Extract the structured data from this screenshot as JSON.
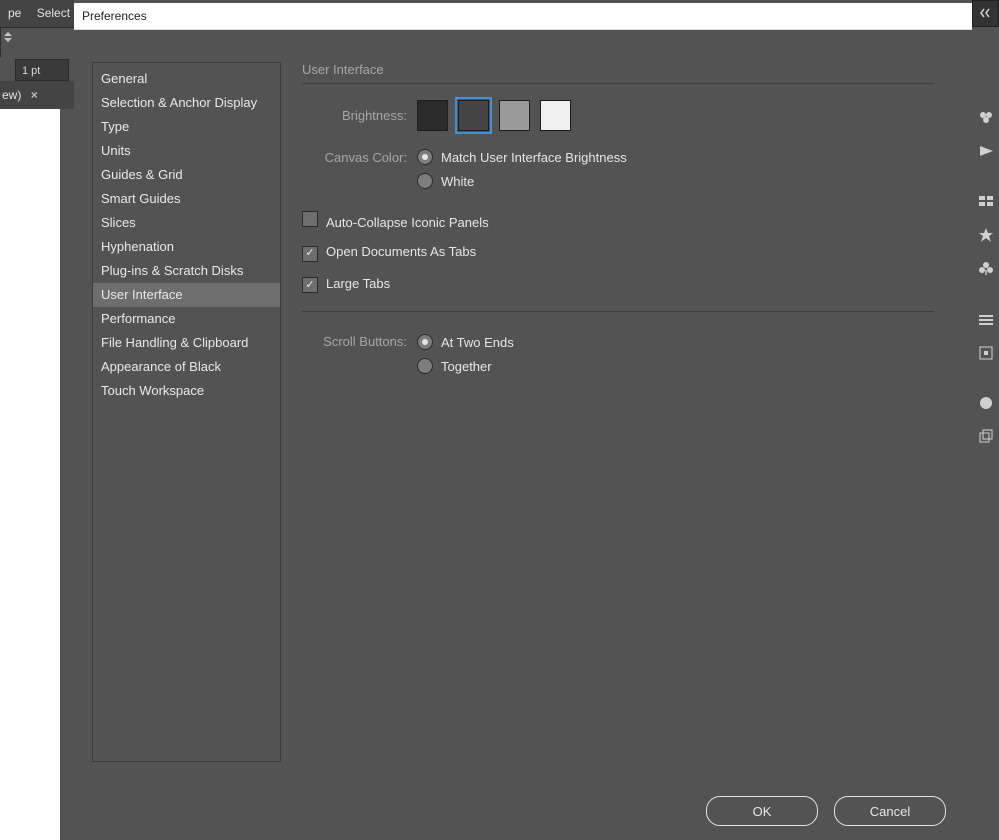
{
  "background": {
    "menu_items": [
      "pe",
      "Select"
    ],
    "stroke_value": "1 pt",
    "doc_tab": "ew)",
    "doc_tab_close": "×"
  },
  "dialog": {
    "title": "Preferences",
    "categories": [
      "General",
      "Selection & Anchor Display",
      "Type",
      "Units",
      "Guides & Grid",
      "Smart Guides",
      "Slices",
      "Hyphenation",
      "Plug-ins & Scratch Disks",
      "User Interface",
      "Performance",
      "File Handling & Clipboard",
      "Appearance of Black",
      "Touch Workspace"
    ],
    "selected_category_index": 9,
    "panel": {
      "heading": "User Interface",
      "brightness_label": "Brightness:",
      "swatches": [
        "#2b2b2b",
        "#444444",
        "#9a9a9a",
        "#f0f0f0"
      ],
      "selected_swatch_index": 1,
      "canvas_color_label": "Canvas Color:",
      "canvas_color_options": [
        "Match User Interface Brightness",
        "White"
      ],
      "canvas_color_selected_index": 0,
      "checkboxes": [
        {
          "label": "Auto-Collapse Iconic Panels",
          "checked": false
        },
        {
          "label": "Open Documents As Tabs",
          "checked": true
        },
        {
          "label": "Large Tabs",
          "checked": true
        }
      ],
      "scroll_label": "Scroll Buttons:",
      "scroll_options": [
        "At Two Ends",
        "Together"
      ],
      "scroll_selected_index": 0
    },
    "buttons": {
      "ok": "OK",
      "cancel": "Cancel"
    }
  }
}
